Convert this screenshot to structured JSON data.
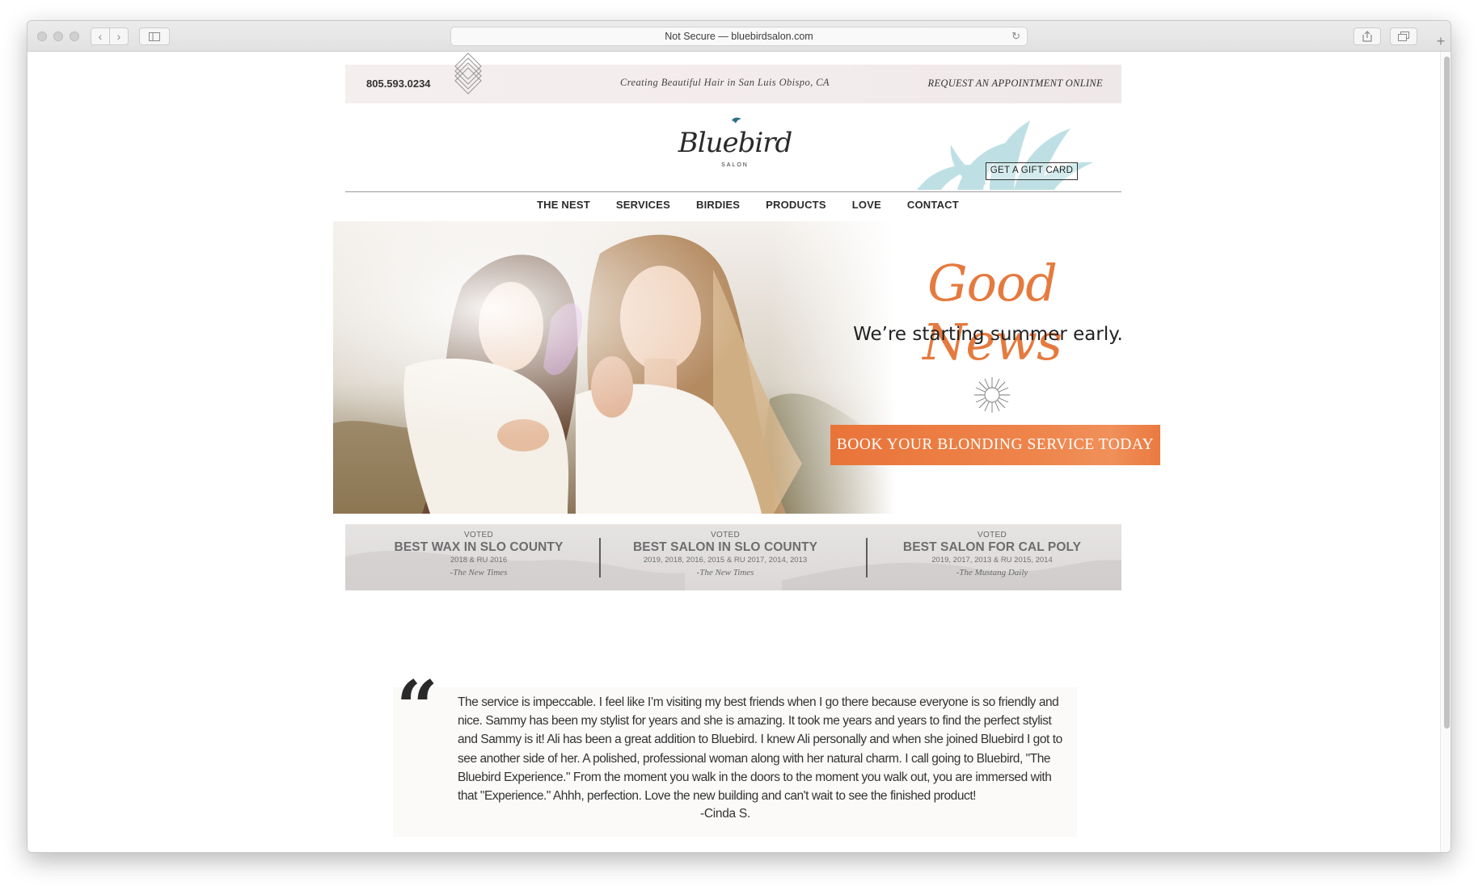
{
  "browser": {
    "address": "Not Secure — bluebirdsalon.com"
  },
  "header": {
    "phone": "805.593.0234",
    "tagline": "Creating Beautiful Hair in San Luis Obispo, CA",
    "request_link": "REQUEST AN APPOINTMENT ONLINE",
    "logo_text": "Bluebird",
    "logo_sub": "SALON",
    "gift_card_label": "GET A GIFT CARD"
  },
  "nav": {
    "items": [
      {
        "label": "THE NEST"
      },
      {
        "label": "SERVICES"
      },
      {
        "label": "BIRDIES"
      },
      {
        "label": "PRODUCTS"
      },
      {
        "label": "LOVE"
      },
      {
        "label": "CONTACT"
      }
    ]
  },
  "hero": {
    "headline": "Good News",
    "subhead": "We’re starting summer early.",
    "cta_label": "BOOK YOUR BLONDING SERVICE TODAY",
    "accent_color": "#e8773d"
  },
  "awards": [
    {
      "voted": "VOTED",
      "title": "BEST WAX IN SLO COUNTY",
      "years": "2018 & RU 2016",
      "source": "-The New Times"
    },
    {
      "voted": "VOTED",
      "title": "BEST SALON IN SLO COUNTY",
      "years": "2019, 2018, 2016, 2015 & RU 2017, 2014, 2013",
      "source": "-The New Times"
    },
    {
      "voted": "VOTED",
      "title": "BEST SALON FOR CAL POLY",
      "years": "2019, 2017, 2013 & RU 2015, 2014",
      "source": "-The Mustang Daily"
    }
  ],
  "testimonial": {
    "text": "The service is impeccable. I feel like I’m visiting my best friends when I go there because everyone is so friendly and nice. Sammy has been my stylist for years and she is amazing. It took me years and years to find the perfect stylist and Sammy is it! Ali has been a great addition to Bluebird. I knew Ali personally and when she joined Bluebird I got to see another side of her. A polished, professional woman along with her natural charm. I call going to Bluebird, \"The Bluebird Experience.\" From the moment you walk in the doors to the moment you walk out, you are immersed with that \"Experience.\" Ahhh, perfection. Love the new building and can't wait to see the finished product!",
    "author": "-Cinda S."
  },
  "carousel": {
    "count": 7,
    "active_index": 1
  }
}
